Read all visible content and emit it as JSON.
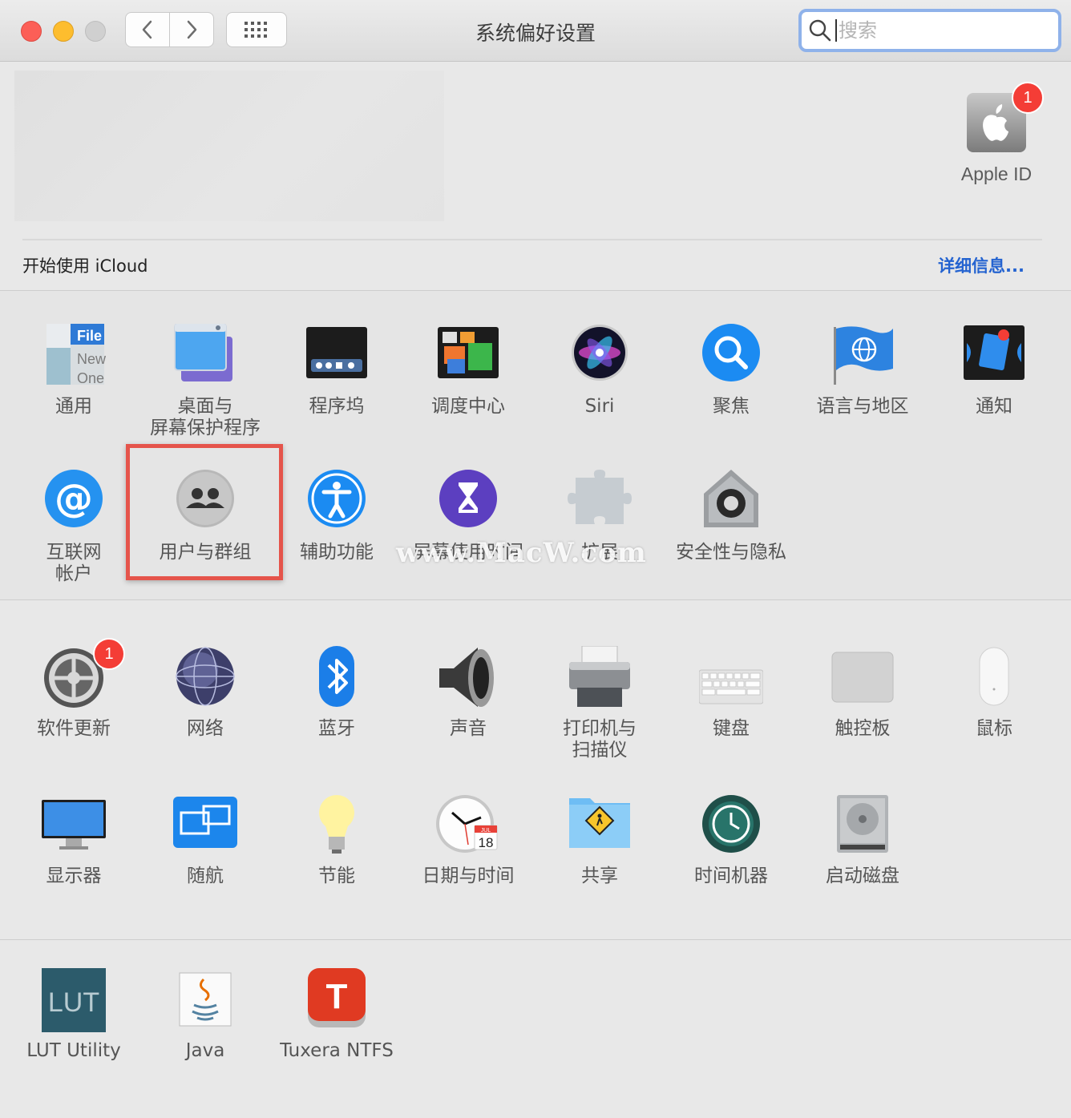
{
  "window": {
    "title": "系统偏好设置",
    "search_placeholder": "搜索"
  },
  "account": {
    "apple_id_label": "Apple ID",
    "apple_id_badge": "1",
    "icloud_prompt": "开始使用 iCloud",
    "details_link": "详细信息..."
  },
  "section1": [
    {
      "name": "通用",
      "icon": "general-icon"
    },
    {
      "name": "桌面与\n屏幕保护程序",
      "icon": "desktop-screensaver-icon"
    },
    {
      "name": "程序坞",
      "icon": "dock-icon"
    },
    {
      "name": "调度中心",
      "icon": "mission-control-icon"
    },
    {
      "name": "Siri",
      "icon": "siri-icon"
    },
    {
      "name": "聚焦",
      "icon": "spotlight-icon"
    },
    {
      "name": "语言与地区",
      "icon": "language-region-icon"
    },
    {
      "name": "通知",
      "icon": "notifications-icon"
    },
    {
      "name": "互联网\n帐户",
      "icon": "internet-accounts-icon"
    },
    {
      "name": "用户与群组",
      "icon": "users-groups-icon"
    },
    {
      "name": "辅助功能",
      "icon": "accessibility-icon"
    },
    {
      "name": "屏幕使用时间",
      "icon": "screen-time-icon"
    },
    {
      "name": "扩展",
      "icon": "extensions-icon"
    },
    {
      "name": "安全性与隐私",
      "icon": "security-privacy-icon"
    }
  ],
  "section2": [
    {
      "name": "软件更新",
      "icon": "software-update-icon",
      "badge": "1"
    },
    {
      "name": "网络",
      "icon": "network-icon"
    },
    {
      "name": "蓝牙",
      "icon": "bluetooth-icon"
    },
    {
      "name": "声音",
      "icon": "sound-icon"
    },
    {
      "name": "打印机与\n扫描仪",
      "icon": "printers-scanners-icon"
    },
    {
      "name": "键盘",
      "icon": "keyboard-icon"
    },
    {
      "name": "触控板",
      "icon": "trackpad-icon"
    },
    {
      "name": "鼠标",
      "icon": "mouse-icon"
    },
    {
      "name": "显示器",
      "icon": "displays-icon"
    },
    {
      "name": "随航",
      "icon": "sidecar-icon"
    },
    {
      "name": "节能",
      "icon": "energy-saver-icon"
    },
    {
      "name": "日期与时间",
      "icon": "date-time-icon",
      "calendar_month": "JUL",
      "calendar_day": "18"
    },
    {
      "name": "共享",
      "icon": "sharing-icon"
    },
    {
      "name": "时间机器",
      "icon": "time-machine-icon"
    },
    {
      "name": "启动磁盘",
      "icon": "startup-disk-icon"
    }
  ],
  "section3": [
    {
      "name": "LUT Utility",
      "icon": "lut-utility-icon",
      "icon_text": "LUT"
    },
    {
      "name": "Java",
      "icon": "java-icon"
    },
    {
      "name": "Tuxera NTFS",
      "icon": "tuxera-ntfs-icon",
      "icon_text": "T"
    }
  ],
  "general_icon_text": [
    "File",
    "New",
    "One"
  ],
  "watermark": "www.MacW.com",
  "colors": {
    "highlight": "#e5544b",
    "badge": "#f43d36",
    "link": "#2463d0"
  }
}
